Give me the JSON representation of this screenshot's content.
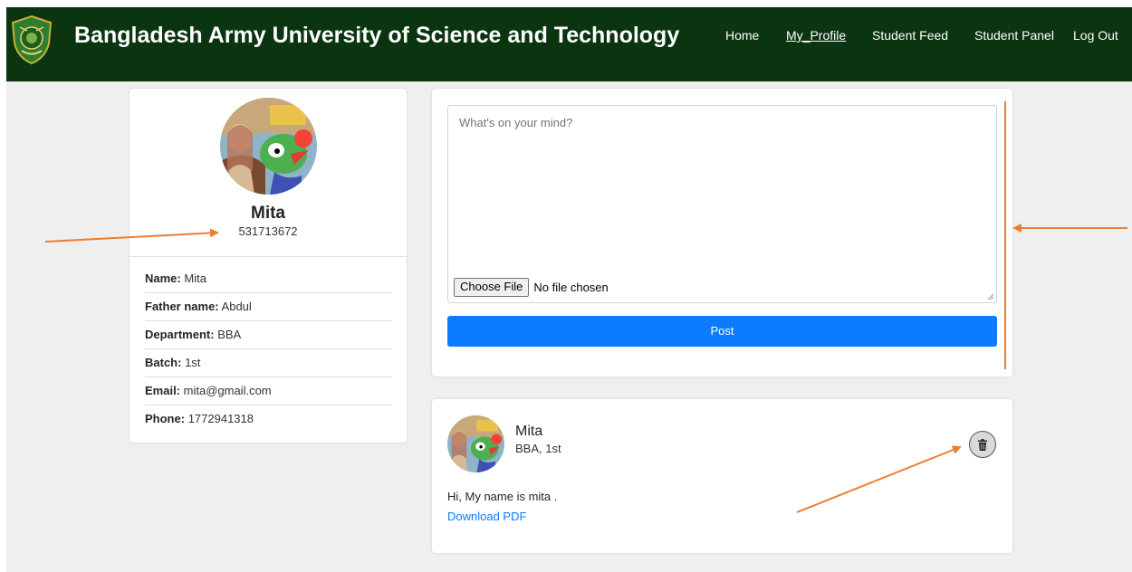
{
  "header": {
    "brand": "Bangladesh Army University of Science and Technology",
    "nav": [
      {
        "label": "Home"
      },
      {
        "label": "My_Profile",
        "active": true
      },
      {
        "label": "Student Feed"
      },
      {
        "label": "Student Panel"
      },
      {
        "label": "Log Out"
      }
    ]
  },
  "profile": {
    "name": "Mita",
    "id": "531713672",
    "details": [
      {
        "label": "Name:",
        "value": "Mita"
      },
      {
        "label": "Father name:",
        "value": "Abdul"
      },
      {
        "label": "Department:",
        "value": "BBA"
      },
      {
        "label": "Batch:",
        "value": "1st"
      },
      {
        "label": "Email:",
        "value": "mita@gmail.com"
      },
      {
        "label": "Phone:",
        "value": "1772941318"
      }
    ]
  },
  "composer": {
    "placeholder": "What's on your mind?",
    "file_button": "Choose File",
    "file_status": "No file chosen",
    "post_button": "Post"
  },
  "feed": {
    "author": "Mita",
    "meta": "BBA, 1st",
    "text": "Hi, My name is mita .",
    "link": "Download PDF"
  },
  "colors": {
    "navbar": "#0b3410",
    "primary": "#0b7cff",
    "annotation_arrow": "#ed7d31"
  }
}
